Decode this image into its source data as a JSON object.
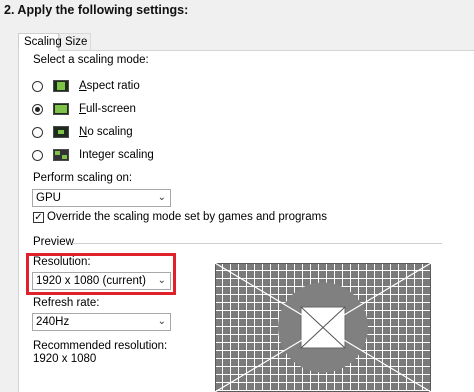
{
  "section_title": "2. Apply the following settings:",
  "tabs": [
    {
      "label": "Scaling",
      "active": true
    },
    {
      "label": "Size",
      "active": false
    }
  ],
  "scaling_mode": {
    "label": "Select a scaling mode:",
    "options": [
      {
        "label": "Aspect ratio",
        "accel": "A",
        "checked": false,
        "icon": "aspect-ratio-icon"
      },
      {
        "label": "Full-screen",
        "accel": "F",
        "checked": true,
        "icon": "full-screen-icon"
      },
      {
        "label": "No scaling",
        "accel": "N",
        "checked": false,
        "icon": "no-scaling-icon"
      },
      {
        "label": "Integer scaling",
        "accel": "",
        "checked": false,
        "icon": "integer-scaling-icon"
      }
    ]
  },
  "perform_scaling": {
    "label": "Perform scaling on:",
    "value": "GPU"
  },
  "override": {
    "label": "Override the scaling mode set by games and programs",
    "checked": true
  },
  "preview": {
    "label": "Preview",
    "resolution_label": "Resolution:",
    "resolution_value": "1920 x 1080 (current)",
    "refresh_label": "Refresh rate:",
    "refresh_value": "240Hz",
    "recommended_label": "Recommended resolution:",
    "recommended_value": "1920 x 1080"
  },
  "colors": {
    "highlight_box": "#e0202a",
    "icon_green": "#7fc24a",
    "preview_gray": "#7a7a7a"
  }
}
